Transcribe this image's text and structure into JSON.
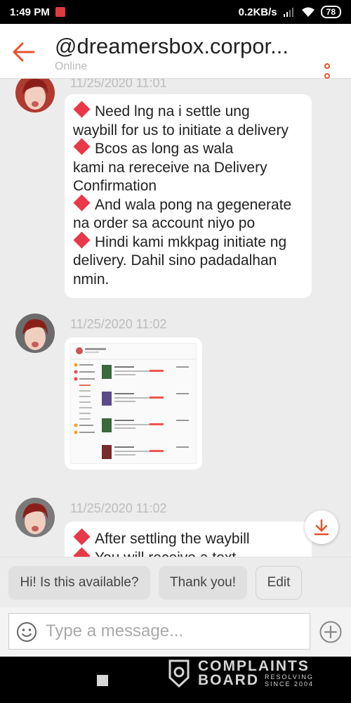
{
  "status_bar": {
    "time": "1:49 PM",
    "network_speed": "0.2KB/s",
    "battery": "78"
  },
  "header": {
    "title": "@dreamersbox.corpor...",
    "subtitle": "Online",
    "back_icon": "back-arrow-icon",
    "menu_icon": "more-vertical-icon",
    "accent_color": "#e5532d"
  },
  "messages": [
    {
      "timestamp": "11/25/2020 11:01",
      "lines": [
        {
          "bullet": true,
          "text": "Need lng na i settle ung"
        },
        {
          "bullet": false,
          "text": "waybill for us to initiate a delivery"
        },
        {
          "bullet": true,
          "text": "Bcos as long as wala"
        },
        {
          "bullet": false,
          "text": "kami na rereceive na Delivery"
        },
        {
          "bullet": false,
          "text": "Confirmation"
        },
        {
          "bullet": true,
          "text": "And wala pong na gegenerate"
        },
        {
          "bullet": false,
          "text": "na order sa account niyo po"
        },
        {
          "bullet": true,
          "text": "Hindi kami mkkpag initiate ng"
        },
        {
          "bullet": false,
          "text": "delivery. Dahil sino padadalhan"
        },
        {
          "bullet": false,
          "text": "nmin."
        }
      ]
    },
    {
      "timestamp": "11/25/2020 11:02",
      "type": "image",
      "image_description": "screenshot-thumbnail"
    },
    {
      "timestamp": "11/25/2020 11:02",
      "lines": [
        {
          "bullet": true,
          "text": "After settling the waybill"
        },
        {
          "bullet": true,
          "text": "You will receive a text"
        }
      ]
    }
  ],
  "quick_replies": [
    "Hi! Is this available?",
    "Thank you!",
    "Edit"
  ],
  "composer": {
    "placeholder": "Type a message...",
    "emoji_icon": "emoji-icon",
    "add_icon": "add-circle-icon"
  },
  "watermark": {
    "line1": "COMPLAINTS",
    "line2": "BOARD",
    "tagline1": "RESOLVING",
    "tagline2": "SINCE 2004"
  },
  "colors": {
    "bullet": "#e8394a",
    "accent": "#e5532d"
  }
}
